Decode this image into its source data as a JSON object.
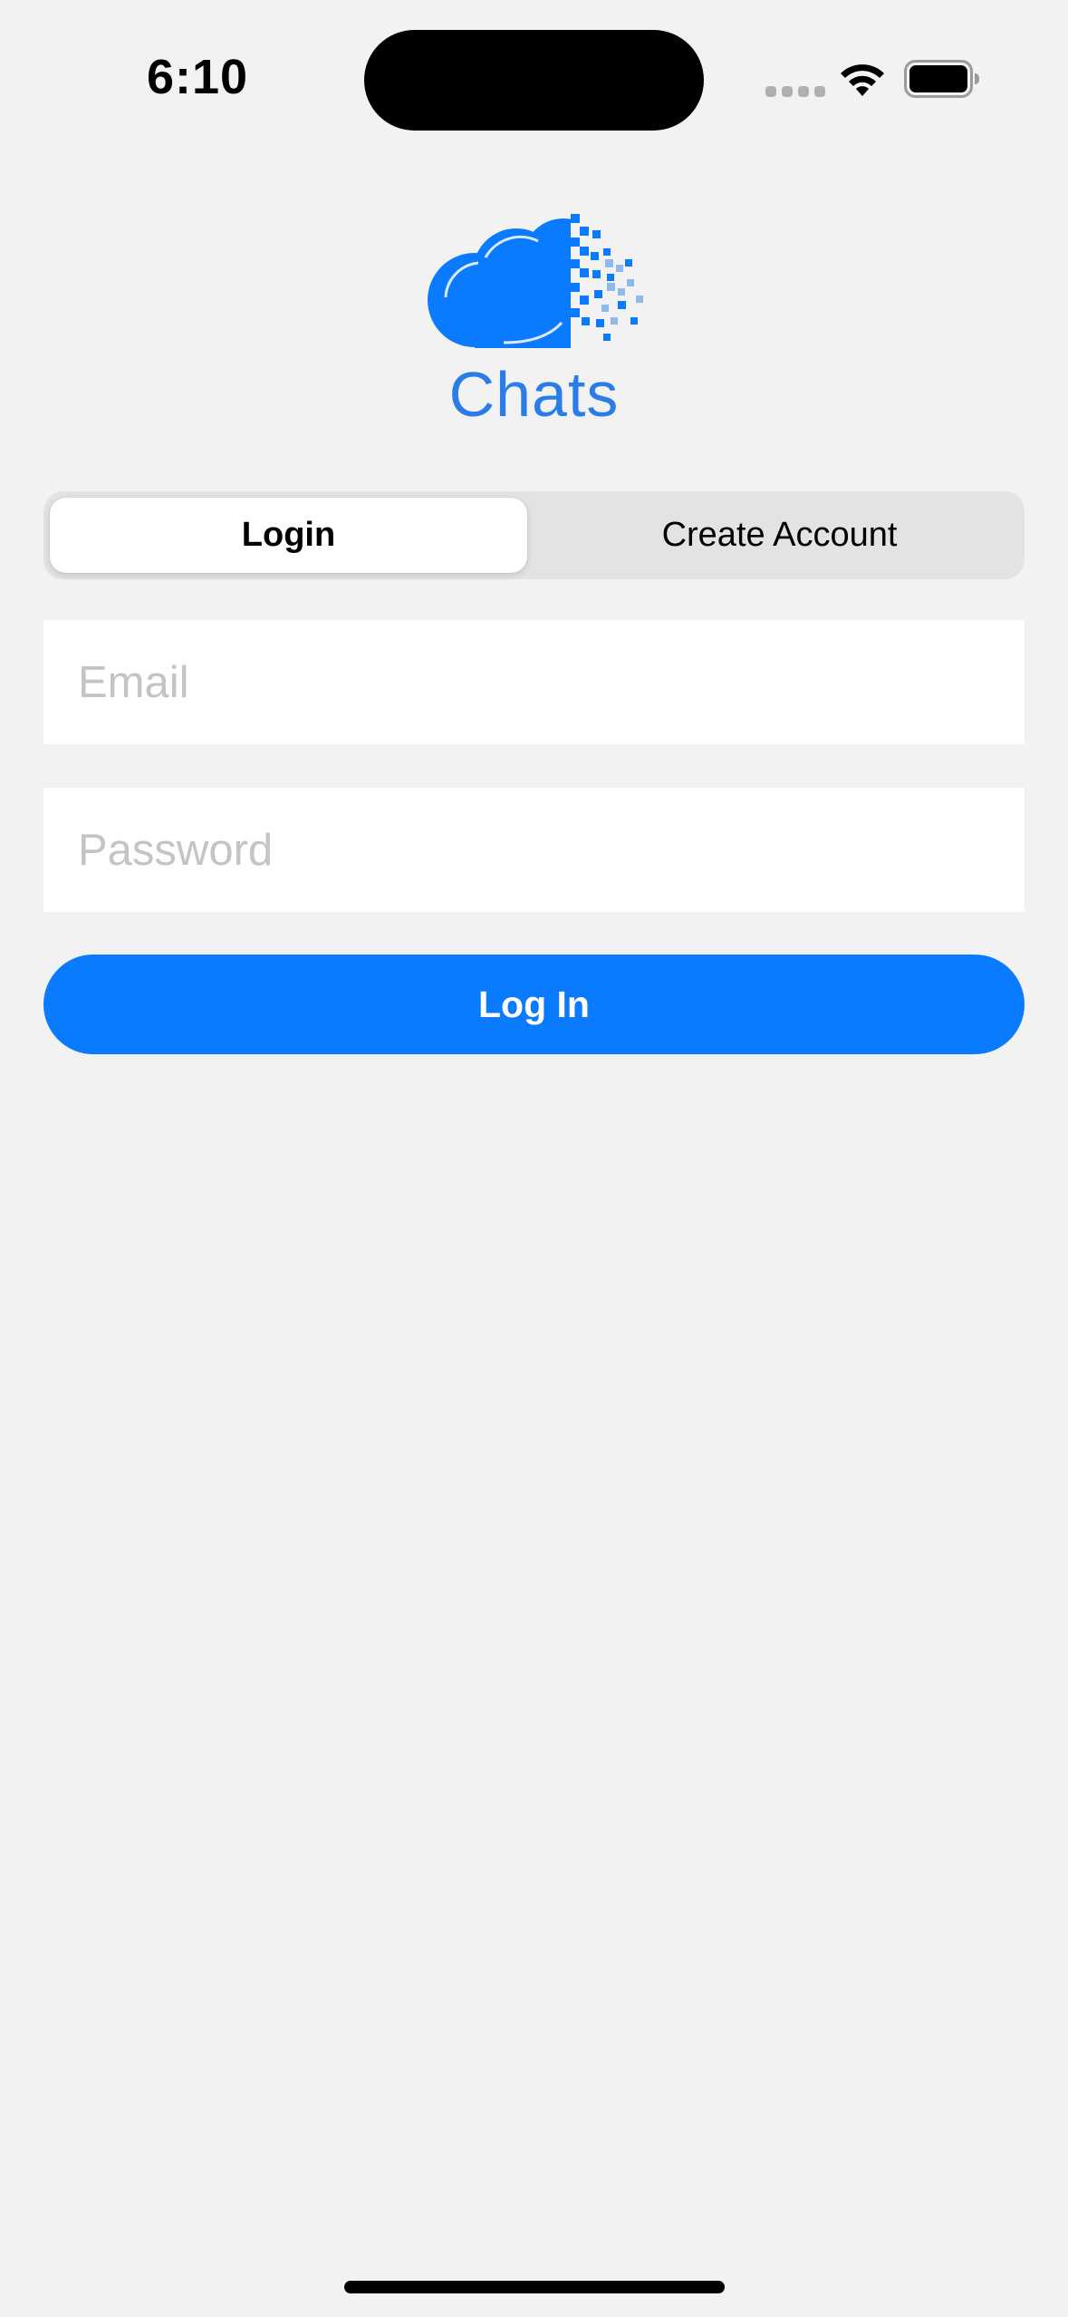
{
  "status_bar": {
    "time": "6:10",
    "wifi_icon": "wifi-icon",
    "battery_icon": "battery-icon"
  },
  "logo": {
    "icon": "cloud-pixel-icon",
    "text": "Chats",
    "color": "#2a7de9"
  },
  "segmented_control": {
    "segments": [
      {
        "label": "Login",
        "selected": true
      },
      {
        "label": "Create Account",
        "selected": false
      }
    ]
  },
  "form": {
    "email": {
      "value": "",
      "placeholder": "Email"
    },
    "password": {
      "value": "",
      "placeholder": "Password"
    },
    "submit_label": "Log In"
  },
  "colors": {
    "accent": "#0a7aff",
    "background": "#f2f2f2"
  }
}
